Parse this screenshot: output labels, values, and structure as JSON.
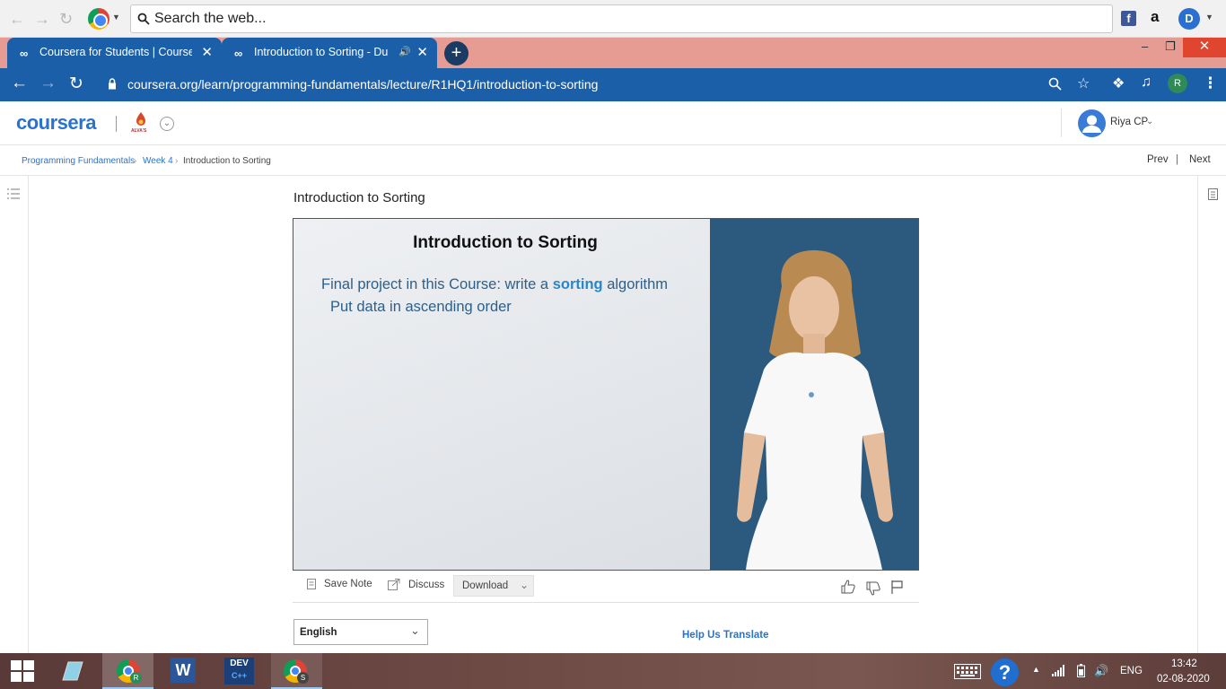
{
  "top_search": {
    "placeholder": "Search the web..."
  },
  "tabs": [
    {
      "label": "Coursera for Students | Coursera"
    },
    {
      "label": "Introduction to Sorting - Duk"
    }
  ],
  "address_bar": {
    "url": "coursera.org/learn/programming-fundamentals/lecture/R1HQ1/introduction-to-sorting",
    "profile_initial": "R"
  },
  "browser_extra": {
    "ext_d_initial": "D"
  },
  "coursera": {
    "logo": "coursera",
    "user_name": "Riya CP",
    "university_emblem_text": "ALVA'S"
  },
  "breadcrumb": {
    "items": [
      "Programming Fundamentals",
      "Week 4",
      "Introduction to Sorting"
    ],
    "prev": "Prev",
    "sep": "|",
    "next": "Next"
  },
  "lecture": {
    "title": "Introduction to Sorting",
    "slide_title": "Introduction to Sorting",
    "bullet1_pre": "Final project in this Course: write a ",
    "bullet1_bold": "sorting",
    "bullet1_post": " algorithm",
    "bullet2": "Put data in ascending order"
  },
  "tools": {
    "save_note": "Save Note",
    "discuss": "Discuss",
    "download": "Download"
  },
  "language": {
    "selected": "English"
  },
  "help_translate": "Help Us Translate",
  "taskbar": {
    "dev_label": "DEV",
    "dev_sub": "C++",
    "chrome_badge_1": "R",
    "chrome_badge_2": "S",
    "help_glyph": "?",
    "lang": "ENG",
    "time": "13:42",
    "date": "02-08-2020"
  },
  "colors": {
    "browser_blue": "#1b5fa8",
    "tabstrip": "#e69b93",
    "coursera_blue": "#2a73cc",
    "close_red": "#e0462f"
  }
}
